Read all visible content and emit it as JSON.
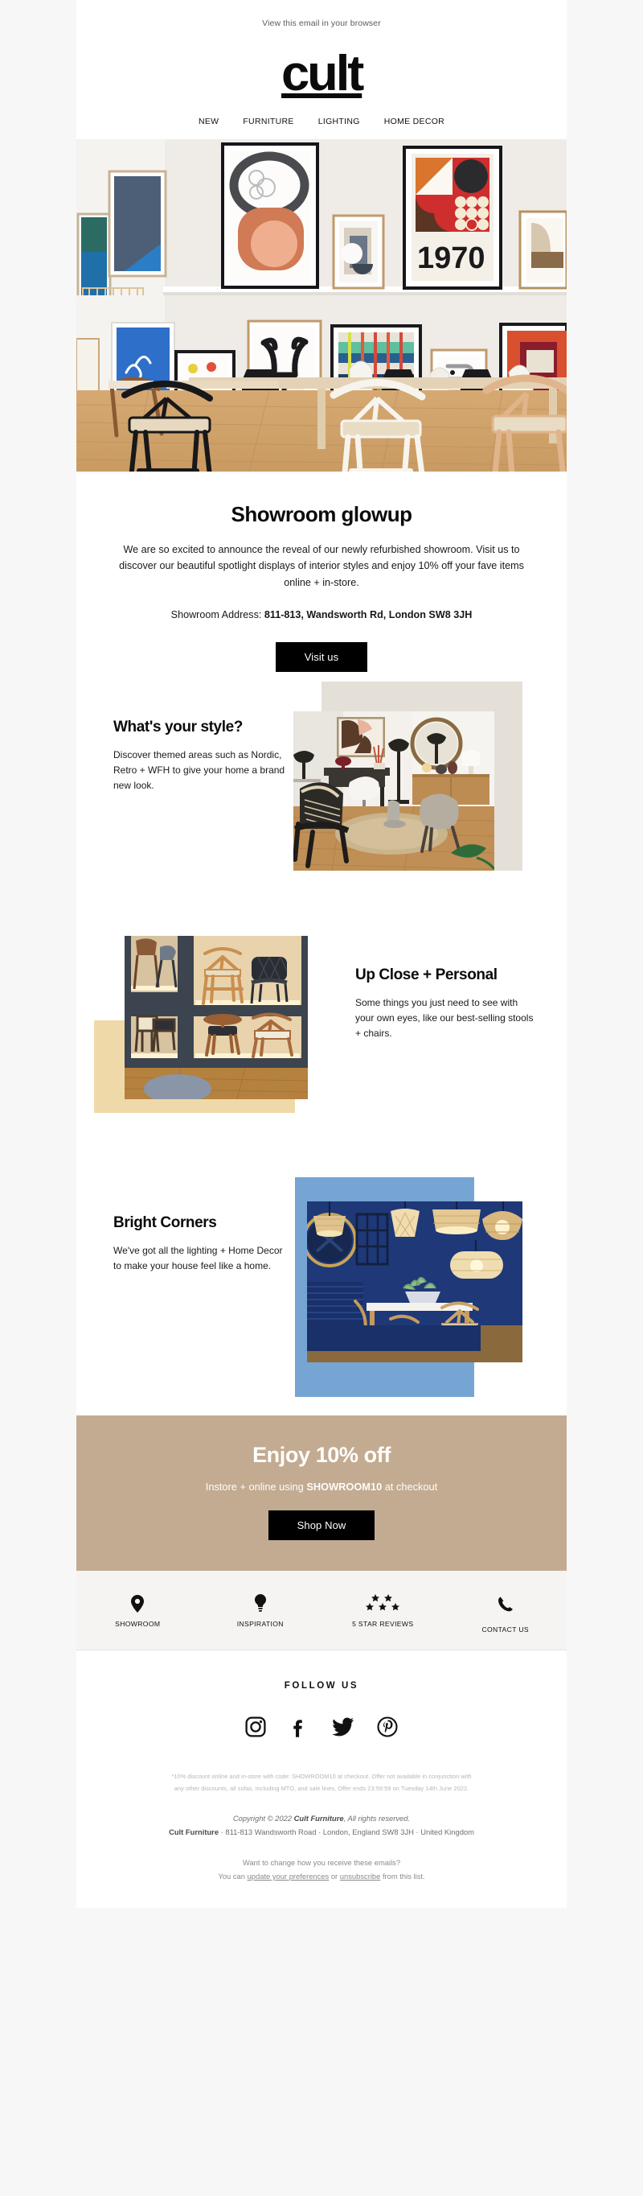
{
  "preheader": {
    "text": "View this email in your browser"
  },
  "brand": {
    "logo_text": "cult",
    "logo_color": "#0b0b0b"
  },
  "nav": {
    "items": [
      {
        "label": "NEW"
      },
      {
        "label": "FURNITURE"
      },
      {
        "label": "LIGHTING"
      },
      {
        "label": "HOME DECOR"
      }
    ]
  },
  "hero": {
    "alt": "Showroom gallery wall with framed art prints above a light wood dining table with wishbone chairs"
  },
  "intro": {
    "heading": "Showroom glowup",
    "body": "We are so excited to announce the reveal of our newly refurbished showroom. Visit us to discover our beautiful spotlight displays of interior styles and enjoy 10% off your fave items online + in-store.",
    "address_label": "Showroom Address:",
    "address_value": "811-813, Wandsworth Rd, London SW8 3JH",
    "cta_label": "Visit us"
  },
  "features": [
    {
      "heading": "What's your style?",
      "body": "Discover themed areas such as Nordic, Retro + WFH to give your home a brand new look.",
      "accent_color": "#e4e0d8",
      "image_alt": "Styled home office corner with desk, mirror, armchair and round jute rug",
      "layout": "text-left"
    },
    {
      "heading": "Up Close + Personal",
      "body": "Some things you just need to see with your own eyes, like our best-selling stools + chairs.",
      "accent_color": "#f0d9a8",
      "image_alt": "Dark display shelving with backlit wooden stools and dining chairs",
      "layout": "text-right"
    },
    {
      "heading": "Bright Corners",
      "body": "We've got all the lighting + Home Decor to make your house feel like a home.",
      "accent_color": "#76a5d4",
      "image_alt": "Navy blue dining room with rattan pendant lights above a white table",
      "layout": "text-left"
    }
  ],
  "promo": {
    "heading": "Enjoy 10% off",
    "line_prefix": "Instore + online using ",
    "code": "SHOWROOM10",
    "line_suffix": " at checkout",
    "cta_label": "Shop Now",
    "background_color": "#c3ab91"
  },
  "icon_strip": {
    "items": [
      {
        "icon": "location-pin-icon",
        "label": "SHOWROOM"
      },
      {
        "icon": "lightbulb-icon",
        "label": "INSPIRATION"
      },
      {
        "icon": "five-stars-icon",
        "label": "5 STAR REVIEWS"
      },
      {
        "icon": "phone-icon",
        "label": "CONTACT US"
      }
    ]
  },
  "follow": {
    "title": "FOLLOW US",
    "socials": [
      {
        "icon": "instagram-icon",
        "name": "Instagram"
      },
      {
        "icon": "facebook-icon",
        "name": "Facebook"
      },
      {
        "icon": "twitter-icon",
        "name": "Twitter"
      },
      {
        "icon": "pinterest-icon",
        "name": "Pinterest"
      }
    ]
  },
  "footer": {
    "disclaimer_line1": "*10% discount online and in-store with code: SHOWROOM10 at checkout. Offer not available in conjunction with",
    "disclaimer_line2": "any other discounts, all sofas, including MTO, and sale lines. Offer ends 23:59:59 on Tuesday 14th June 2022.",
    "copyright_prefix": "Copyright © 2022 ",
    "copyright_brand": "Cult Furniture",
    "copyright_suffix": ", All rights reserved.",
    "address_brand": "Cult Furniture",
    "address_rest": " · 811-813 Wandsworth Road · London, England SW8 3JH · United Kingdom",
    "prefs_line1": "Want to change how you receive these emails?",
    "prefs_prefix": "You can ",
    "prefs_link1": "update your preferences",
    "prefs_middle": " or ",
    "prefs_link2": "unsubscribe",
    "prefs_suffix": " from this list."
  }
}
